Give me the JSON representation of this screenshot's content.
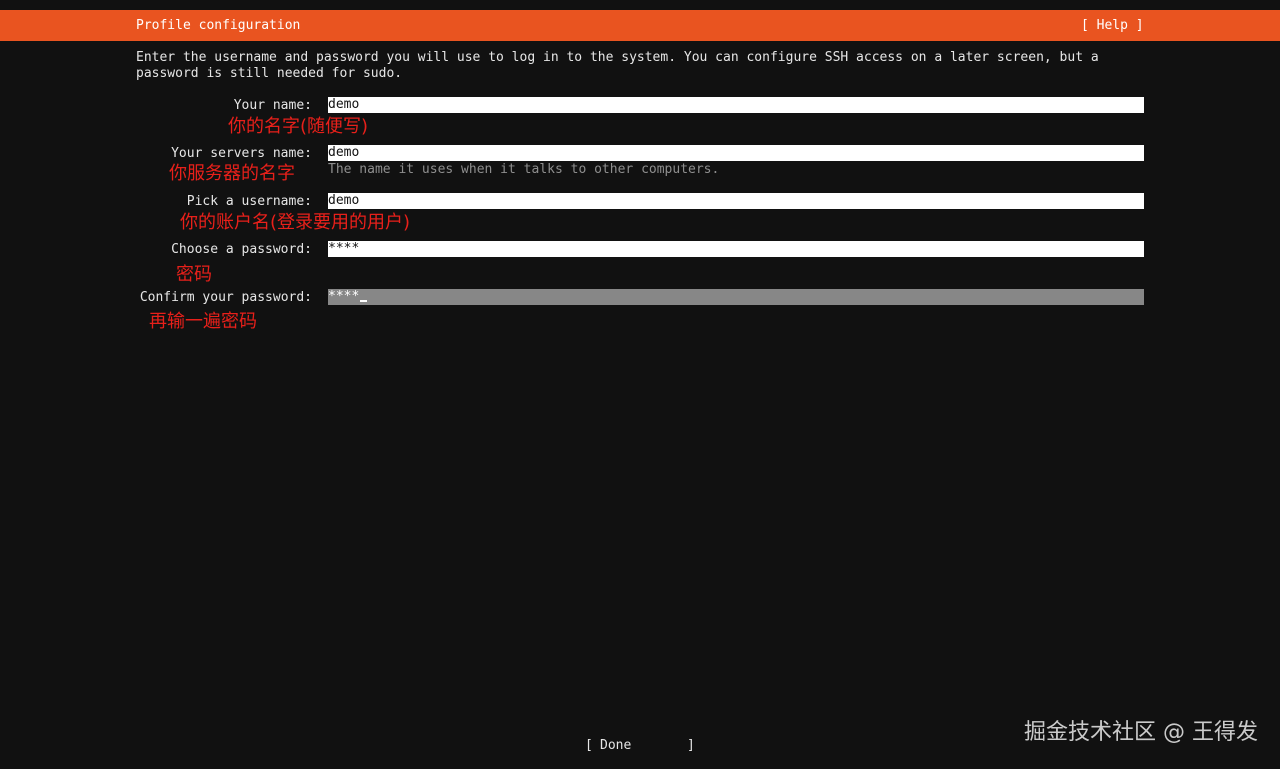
{
  "header": {
    "title": "Profile configuration",
    "help_label": "[ Help ]"
  },
  "intro": "Enter the username and password you will use to log in to the system. You can configure SSH access on a later screen, but a password is still needed for sudo.",
  "fields": {
    "your_name": {
      "label": "Your name:",
      "value": "demo"
    },
    "server_name": {
      "label": "Your servers name:",
      "value": "demo",
      "hint": "The name it uses when it talks to other computers."
    },
    "username": {
      "label": "Pick a username:",
      "value": "demo"
    },
    "password": {
      "label": "Choose a password:",
      "value": "****"
    },
    "confirm_password": {
      "label": "Confirm your password:",
      "value": "****"
    }
  },
  "annotations": {
    "your_name": "你的名字(随便写)",
    "server_name": "你服务器的名字",
    "username": "你的账户名(登录要用的用户)",
    "password": "密码",
    "confirm_password": "再输一遍密码"
  },
  "footer": {
    "done_open": "[",
    "done_label": "Done",
    "done_close": "]"
  },
  "watermark": "掘金技术社区 @ 王得发",
  "colors": {
    "accent": "#e95420",
    "background": "#111111",
    "annotation": "#e8201a",
    "active_field": "#878787"
  }
}
